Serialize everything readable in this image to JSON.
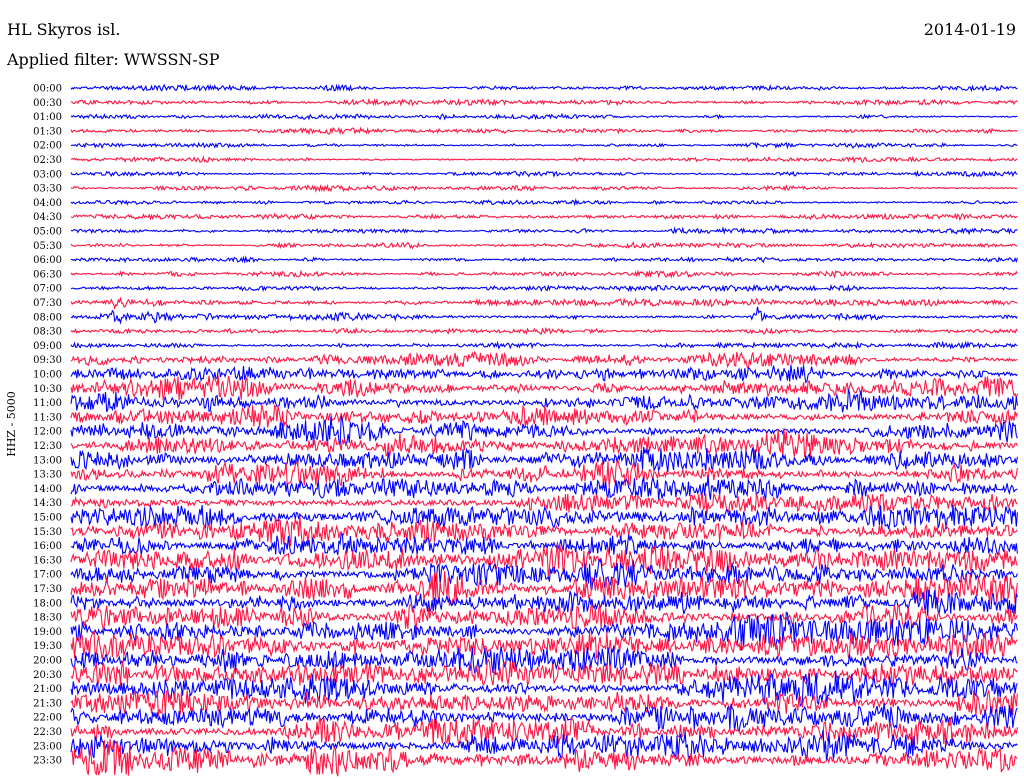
{
  "header": {
    "station": "HL Skyros isl.",
    "date": "2014-01-19",
    "filter": "Applied filter: WWSSN-SP",
    "channel": "HHZ - 5000"
  },
  "chart_data": {
    "type": "line",
    "title": "HL Skyros isl.",
    "subtitle": "Applied filter: WWSSN-SP",
    "ylabel": "HHZ - 5000",
    "xlabel": "",
    "grid": false,
    "rows": [
      "00:00",
      "00:30",
      "01:00",
      "01:30",
      "02:00",
      "02:30",
      "03:00",
      "03:30",
      "04:00",
      "04:30",
      "05:00",
      "05:30",
      "06:00",
      "06:30",
      "07:00",
      "07:30",
      "08:00",
      "08:30",
      "09:00",
      "09:30",
      "10:00",
      "10:30",
      "11:00",
      "11:30",
      "12:00",
      "12:30",
      "13:00",
      "13:30",
      "14:00",
      "14:30",
      "15:00",
      "15:30",
      "16:00",
      "16:30",
      "17:00",
      "17:30",
      "18:00",
      "18:30",
      "19:00",
      "19:30",
      "20:00",
      "20:30",
      "21:00",
      "21:30",
      "22:00",
      "22:30",
      "23:00",
      "23:30"
    ],
    "trace_colors": [
      "#0000ff",
      "#ff1744"
    ],
    "relative_amplitude": [
      0.35,
      0.35,
      0.35,
      0.35,
      0.35,
      0.35,
      0.35,
      0.35,
      0.35,
      0.35,
      0.35,
      0.35,
      0.35,
      0.35,
      0.35,
      0.4,
      0.55,
      0.4,
      0.45,
      0.8,
      1.1,
      1.3,
      1.35,
      1.4,
      1.45,
      1.45,
      1.5,
      1.5,
      1.5,
      1.5,
      1.55,
      1.55,
      1.6,
      1.6,
      1.75,
      1.8,
      1.8,
      1.85,
      1.85,
      1.85,
      1.85,
      1.85,
      1.85,
      1.85,
      1.9,
      1.9,
      2.0,
      2.1
    ]
  }
}
